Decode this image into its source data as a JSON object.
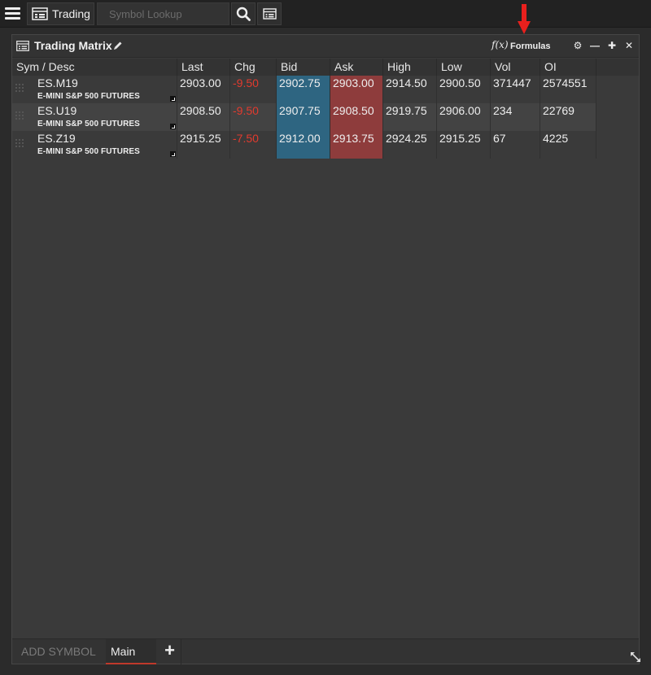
{
  "topbar": {
    "trading_label": "Trading",
    "search_placeholder": "Symbol Lookup"
  },
  "panel": {
    "title": "Trading Matrix",
    "fx_symbol": "f(x)",
    "formulas_label": "Formulas",
    "controls": {
      "settings": "⚙",
      "minimize": "—",
      "add": "✚",
      "close": "✕"
    }
  },
  "columns": [
    "Sym / Desc",
    "Last",
    "Chg",
    "Bid",
    "Ask",
    "High",
    "Low",
    "Vol",
    "OI"
  ],
  "rows": [
    {
      "sym": "ES.M19",
      "desc": "E-MINI S&P 500 FUTURES",
      "last": "2903.00",
      "chg": "-9.50",
      "bid": "2902.75",
      "ask": "2903.00",
      "high": "2914.50",
      "low": "2900.50",
      "vol": "371447",
      "oi": "2574551"
    },
    {
      "sym": "ES.U19",
      "desc": "E-MINI S&P 500 FUTURES",
      "last": "2908.50",
      "chg": "-9.50",
      "bid": "2907.75",
      "ask": "2908.50",
      "high": "2919.75",
      "low": "2906.00",
      "vol": "234",
      "oi": "22769"
    },
    {
      "sym": "ES.Z19",
      "desc": "E-MINI S&P 500 FUTURES",
      "last": "2915.25",
      "chg": "-7.50",
      "bid": "2912.00",
      "ask": "2913.75",
      "high": "2924.25",
      "low": "2915.25",
      "vol": "67",
      "oi": "4225"
    }
  ],
  "tabs": {
    "add_symbol": "ADD SYMBOL",
    "main": "Main",
    "add_tab": "+"
  },
  "colors": {
    "background": "#2b2b2b",
    "panel": "#3a3a3a",
    "bid": "#2e6581",
    "ask": "#8e3c3c",
    "negative": "#e23a2e",
    "annotation_arrow": "#e8201d"
  }
}
